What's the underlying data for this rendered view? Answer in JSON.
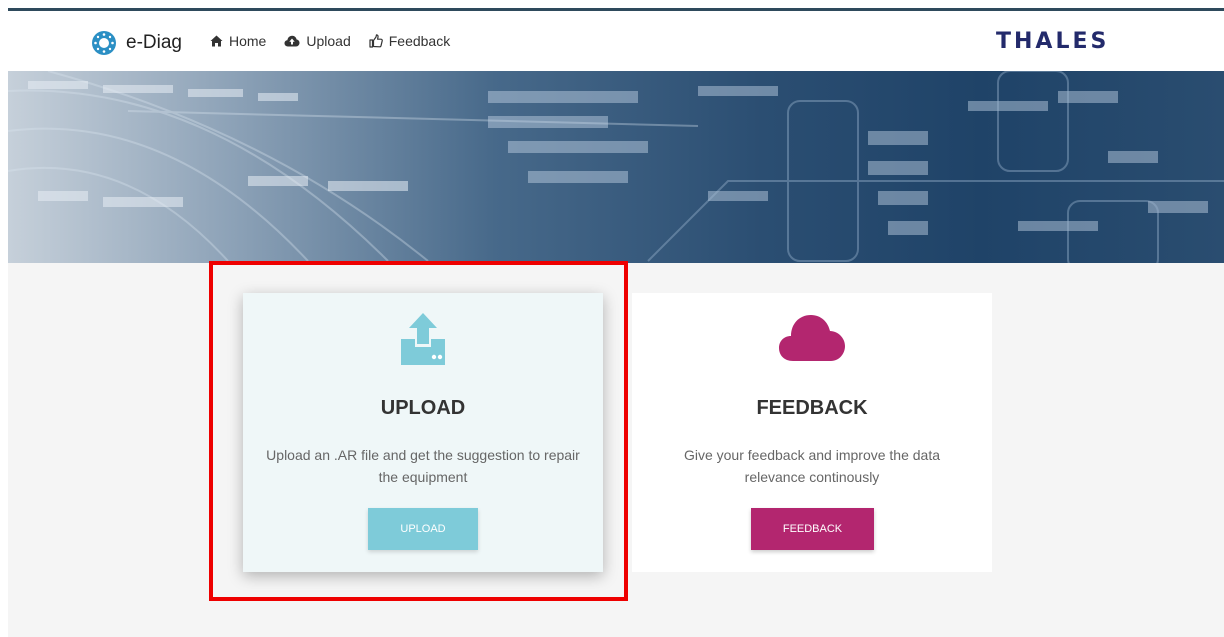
{
  "app": {
    "name": "e-Diag",
    "logo_icon": "ediag-logo-icon"
  },
  "nav": {
    "items": [
      {
        "label": "Home",
        "icon": "home-icon"
      },
      {
        "label": "Upload",
        "icon": "cloud-upload-icon"
      },
      {
        "label": "Feedback",
        "icon": "thumbs-up-icon"
      }
    ]
  },
  "company": {
    "name": "THALES"
  },
  "cards": {
    "upload": {
      "title": "UPLOAD",
      "description": "Upload an .AR file and get the suggestion to repair the equipment",
      "button_label": "UPLOAD",
      "icon": "upload-tray-icon",
      "accent": "#7ecbd9"
    },
    "feedback": {
      "title": "FEEDBACK",
      "description": "Give your feedback and improve the data relevance continously",
      "button_label": "FEEDBACK",
      "icon": "cloud-icon",
      "accent": "#b3266f"
    }
  },
  "colors": {
    "highlight": "#ee0000",
    "brand_dark": "#232a6b"
  }
}
